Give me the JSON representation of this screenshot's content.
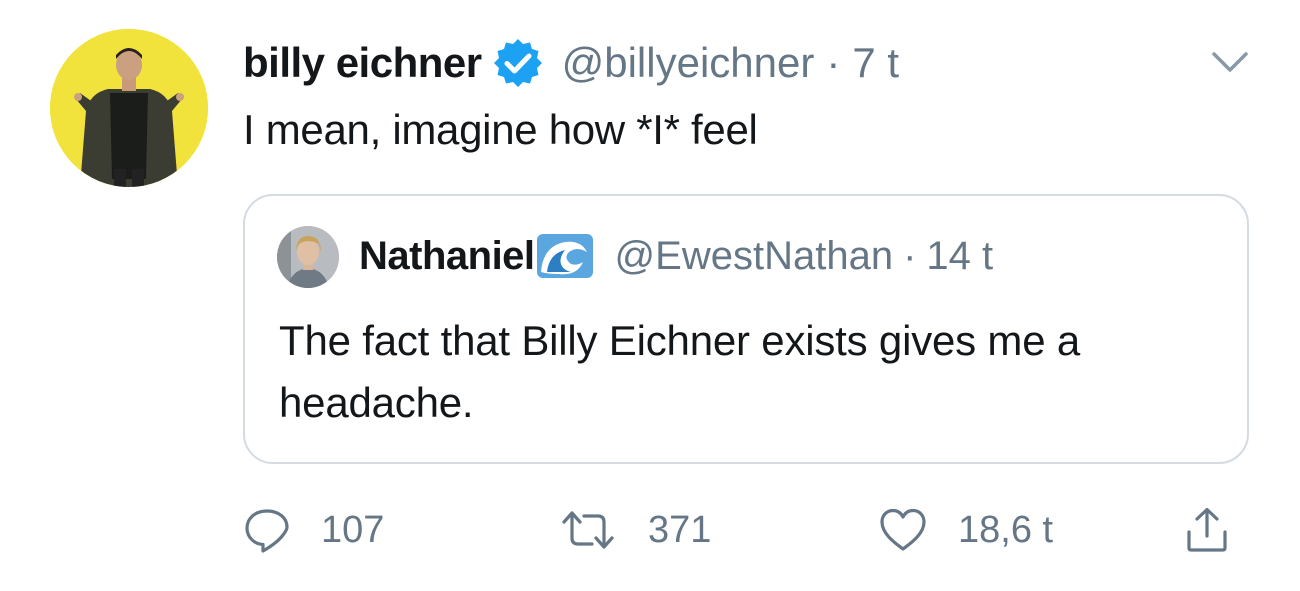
{
  "tweet": {
    "author": {
      "display_name": "billy eichner",
      "verified": true,
      "handle": "@billyeichner",
      "time": "7 t"
    },
    "separator": "·",
    "text": "I mean, imagine how *I* feel",
    "quoted": {
      "display_name": "Nathaniel",
      "handle": "@EwestNathan",
      "time": "14 t",
      "text": "The fact that Billy Eichner exists gives me a headache."
    },
    "actions": {
      "reply_count": "107",
      "retweet_count": "371",
      "like_count": "18,6 t"
    }
  },
  "icons": {
    "verified": "verified-badge-icon",
    "caret": "chevron-down-icon",
    "name_emoji": "water-wave-icon",
    "reply": "speech-bubble-icon",
    "retweet": "retweet-arrows-icon",
    "like": "heart-icon",
    "share": "share-upload-icon"
  },
  "colors": {
    "text_primary": "#14171a",
    "text_secondary": "#657786",
    "verified_blue": "#1da1f2",
    "quote_border": "#d4dbe1",
    "avatar_bg": "#f2e33c"
  }
}
